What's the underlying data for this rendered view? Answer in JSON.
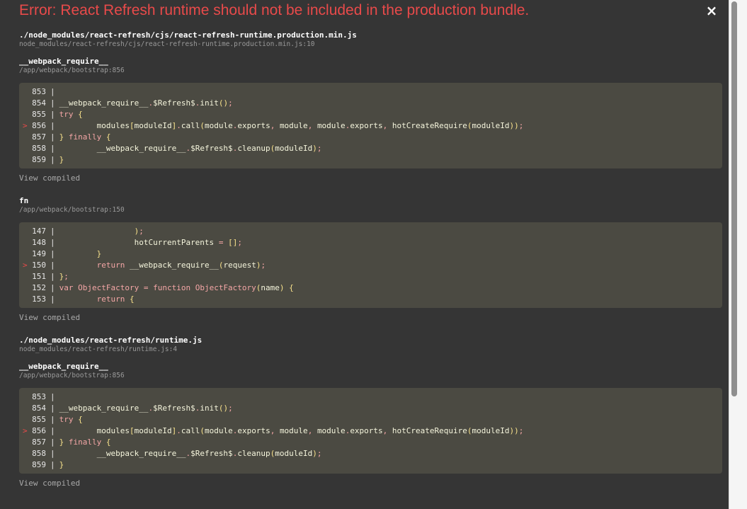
{
  "header": {
    "title": "Error: React Refresh runtime should not be included in the production bundle.",
    "close_label": "×"
  },
  "frames": [
    {
      "name": "./node_modules/react-refresh/cjs/react-refresh-runtime.production.min.js",
      "location": "node_modules/react-refresh/cjs/react-refresh-runtime.production.min.js:10"
    },
    {
      "name": "__webpack_require__",
      "location": "/app/webpack/bootstrap:856",
      "view_compiled": "View compiled",
      "code": [
        {
          "num": "853",
          "text": ""
        },
        {
          "num": "854",
          "text": "__webpack_require__.$Refresh$.init();"
        },
        {
          "num": "855",
          "text": "try {"
        },
        {
          "num": "856",
          "text": "        modules[moduleId].call(module.exports, module, module.exports, hotCreateRequire(moduleId));",
          "highlight": true
        },
        {
          "num": "857",
          "text": "} finally {"
        },
        {
          "num": "858",
          "text": "        __webpack_require__.$Refresh$.cleanup(moduleId);"
        },
        {
          "num": "859",
          "text": "}"
        }
      ]
    },
    {
      "name": "fn",
      "location": "/app/webpack/bootstrap:150",
      "view_compiled": "View compiled",
      "code": [
        {
          "num": "147",
          "text": "                );"
        },
        {
          "num": "148",
          "text": "                hotCurrentParents = [];"
        },
        {
          "num": "149",
          "text": "        }"
        },
        {
          "num": "150",
          "text": "        return __webpack_require__(request);",
          "highlight": true
        },
        {
          "num": "151",
          "text": "};"
        },
        {
          "num": "152",
          "text": "var ObjectFactory = function ObjectFactory(name) {"
        },
        {
          "num": "153",
          "text": "        return {"
        }
      ]
    },
    {
      "name": "./node_modules/react-refresh/runtime.js",
      "location": "node_modules/react-refresh/runtime.js:4"
    },
    {
      "name": "__webpack_require__",
      "location": "/app/webpack/bootstrap:856",
      "view_compiled": "View compiled",
      "code": [
        {
          "num": "853",
          "text": ""
        },
        {
          "num": "854",
          "text": "__webpack_require__.$Refresh$.init();"
        },
        {
          "num": "855",
          "text": "try {"
        },
        {
          "num": "856",
          "text": "        modules[moduleId].call(module.exports, module, module.exports, hotCreateRequire(moduleId));",
          "highlight": true
        },
        {
          "num": "857",
          "text": "} finally {"
        },
        {
          "num": "858",
          "text": "        __webpack_require__.$Refresh$.cleanup(moduleId);"
        },
        {
          "num": "859",
          "text": "}"
        }
      ]
    }
  ],
  "colors": {
    "error": "#e84a4a",
    "background": "#353535",
    "code_background": "#4b4a42"
  }
}
